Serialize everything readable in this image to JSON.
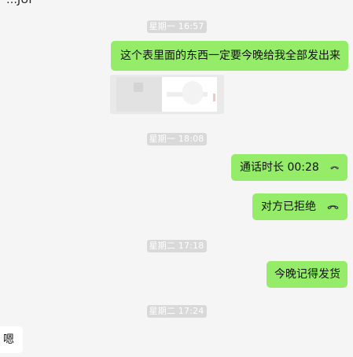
{
  "header": {
    "partial_text": "…JUI"
  },
  "timestamps": {
    "t1": "星期一 16:57",
    "t2": "星期一 18:08",
    "t3": "星期二 17:18",
    "t4": "星期二 17:24"
  },
  "messages": {
    "m1": "这个表里面的东西一定要今晚给我全部发出来",
    "m2_call": "通话时长 00:28",
    "m3_call": "对方已拒绝",
    "m4": "今晚记得发货",
    "m5": "嗯"
  },
  "icons": {
    "call": "phone-handset-icon"
  },
  "colors": {
    "background": "#f5f5f5",
    "my_bubble": "#95ec69",
    "other_bubble": "#ffffff",
    "timestamp_bg": "#d9d9d9"
  }
}
